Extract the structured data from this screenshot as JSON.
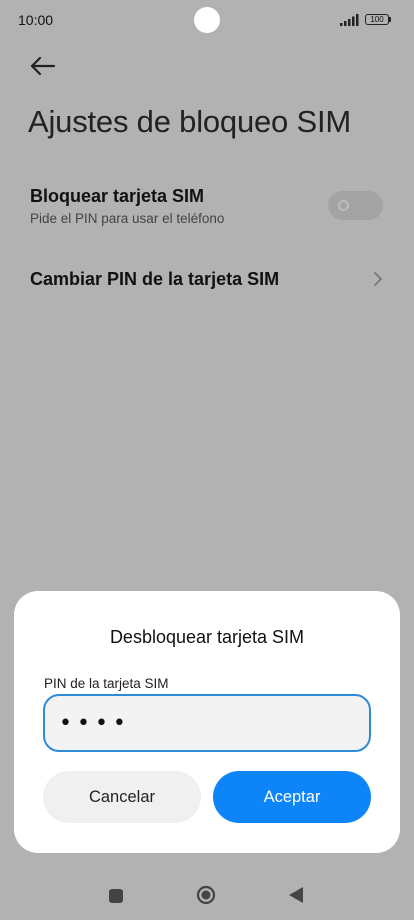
{
  "status_bar": {
    "time": "10:00",
    "battery_level": "100",
    "signal_icon": "signal-icon",
    "battery_icon": "battery-icon"
  },
  "header": {
    "back_icon": "arrow-left-icon",
    "title": "Ajustes de bloqueo SIM"
  },
  "settings": {
    "lock_sim": {
      "title": "Bloquear tarjeta SIM",
      "subtitle": "Pide el PIN para usar el teléfono",
      "enabled": false
    },
    "change_pin": {
      "title": "Cambiar PIN de la tarjeta SIM",
      "icon": "chevron-right-icon"
    }
  },
  "dialog": {
    "title": "Desbloquear tarjeta SIM",
    "field_label": "PIN de la tarjeta SIM",
    "pin_value": "••••",
    "cancel_label": "Cancelar",
    "accept_label": "Aceptar"
  },
  "colors": {
    "accent": "#0d84f7",
    "input_border": "#2e8bd8",
    "scrim": "#b2b2b2"
  },
  "nav_bar": {
    "recent_icon": "square-icon",
    "home_icon": "circle-home-icon",
    "back_icon": "triangle-back-icon"
  }
}
